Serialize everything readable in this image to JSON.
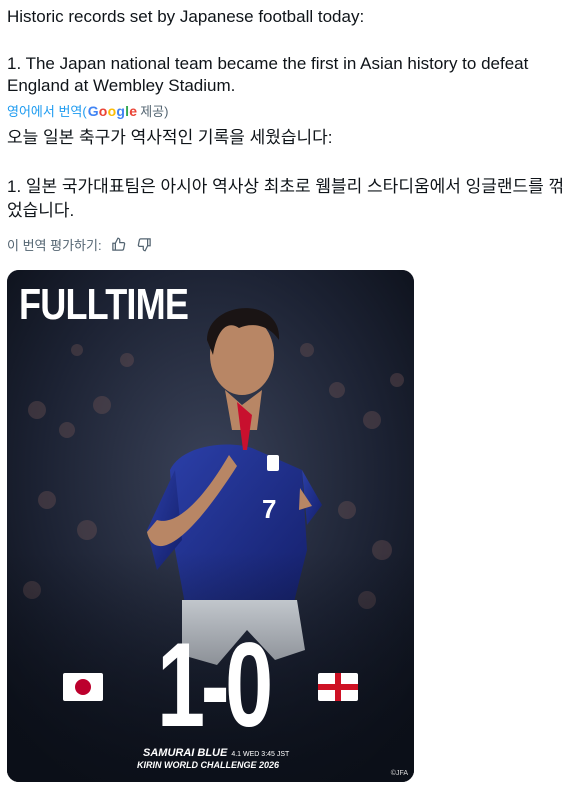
{
  "post": {
    "english_line1": "Historic records set by Japanese football today:",
    "english_line2": "1. The Japan national team became the first in Asian history to defeat England at Wembley Stadium.",
    "translated_from": "영어에서 번역(",
    "google": [
      "G",
      "o",
      "o",
      "g",
      "l",
      "e"
    ],
    "provided": "제공)",
    "korean_line1": "오늘 일본 축구가 역사적인 기록을 세웠습니다:",
    "korean_line2": "1. 일본 국가대표팀은 아시아 역사상 최초로 웸블리 스타디움에서 잉글랜드를 꺾었습니다.",
    "rate_label": "이 번역 평가하기:"
  },
  "media": {
    "headline": "FULLTIME",
    "score": "1-0",
    "team_line": "SAMURAI BLUE",
    "date_small": "4.1 WED 3:45 JST",
    "event": "KIRIN WORLD CHALLENGE 2026",
    "credit": "©JFA",
    "shirt_number": "7"
  },
  "icons": [
    "thumbs-up-icon",
    "thumbs-down-icon"
  ]
}
